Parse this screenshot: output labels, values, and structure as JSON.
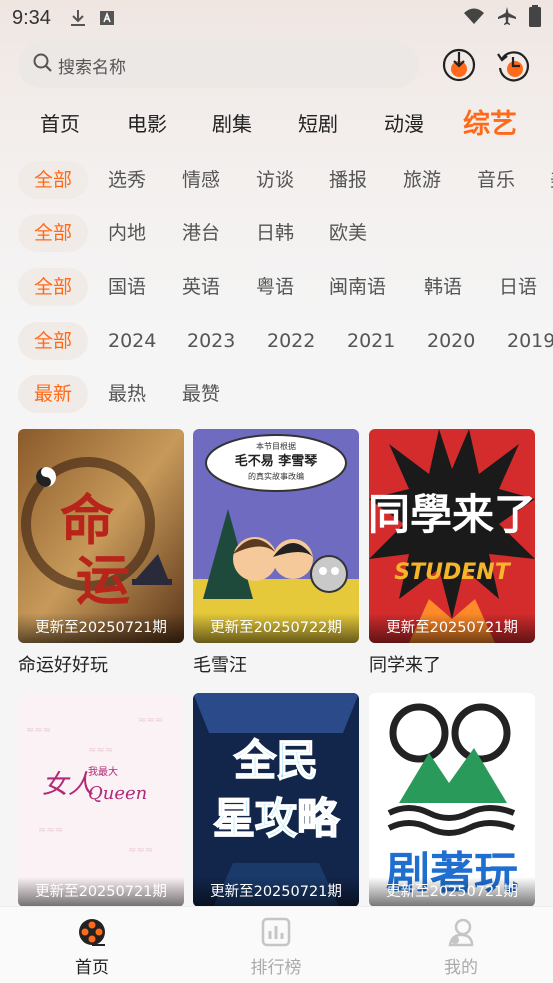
{
  "status_bar": {
    "time": "9:34",
    "icons": [
      "download-icon",
      "a-badge-icon",
      "wifi-icon",
      "airplane-icon",
      "battery-icon"
    ]
  },
  "search": {
    "placeholder": "搜索名称"
  },
  "header_icons": [
    "download-icon",
    "history-icon"
  ],
  "category_tabs": [
    {
      "label": "首页"
    },
    {
      "label": "电影"
    },
    {
      "label": "剧集"
    },
    {
      "label": "短剧"
    },
    {
      "label": "动漫"
    },
    {
      "label": "综艺",
      "active": true
    }
  ],
  "filters": {
    "type": [
      "全部",
      "选秀",
      "情感",
      "访谈",
      "播报",
      "旅游",
      "音乐",
      "美"
    ],
    "region": [
      "全部",
      "内地",
      "港台",
      "日韩",
      "欧美"
    ],
    "language": [
      "全部",
      "国语",
      "英语",
      "粤语",
      "闽南语",
      "韩语",
      "日语"
    ],
    "year": [
      "全部",
      "2024",
      "2023",
      "2022",
      "2021",
      "2020",
      "2019"
    ],
    "sort": [
      "最新",
      "最热",
      "最赞"
    ]
  },
  "items": [
    {
      "title": "命运好好玩",
      "update": "更新至20250721期"
    },
    {
      "title": "毛雪汪",
      "update": "更新至20250722期"
    },
    {
      "title": "同学来了",
      "update": "更新至20250721期"
    },
    {
      "title": "",
      "update": "更新至20250721期"
    },
    {
      "title": "",
      "update": "更新至20250721期"
    },
    {
      "title": "",
      "update": "更新至20250721期"
    }
  ],
  "poster_text": {
    "p2_line1": "本节目根据",
    "p2_line2": "毛不易  李雪琴",
    "p2_line3": "的真实故事改编",
    "p3_main": "同學来了",
    "p3_sub": "STUDENT",
    "p4_brand": "我最大",
    "p4_main": "女人",
    "p4_sub": "Queen",
    "p5_line1": "全民",
    "p5_line2": "星攻略",
    "p6_text": "剧著玩"
  },
  "bottom_nav": [
    {
      "label": "首页",
      "active": true
    },
    {
      "label": "排行榜"
    },
    {
      "label": "我的"
    }
  ],
  "colors": {
    "accent": "#ff6a1a",
    "text": "#222222",
    "inactive": "#aaaaaa"
  }
}
